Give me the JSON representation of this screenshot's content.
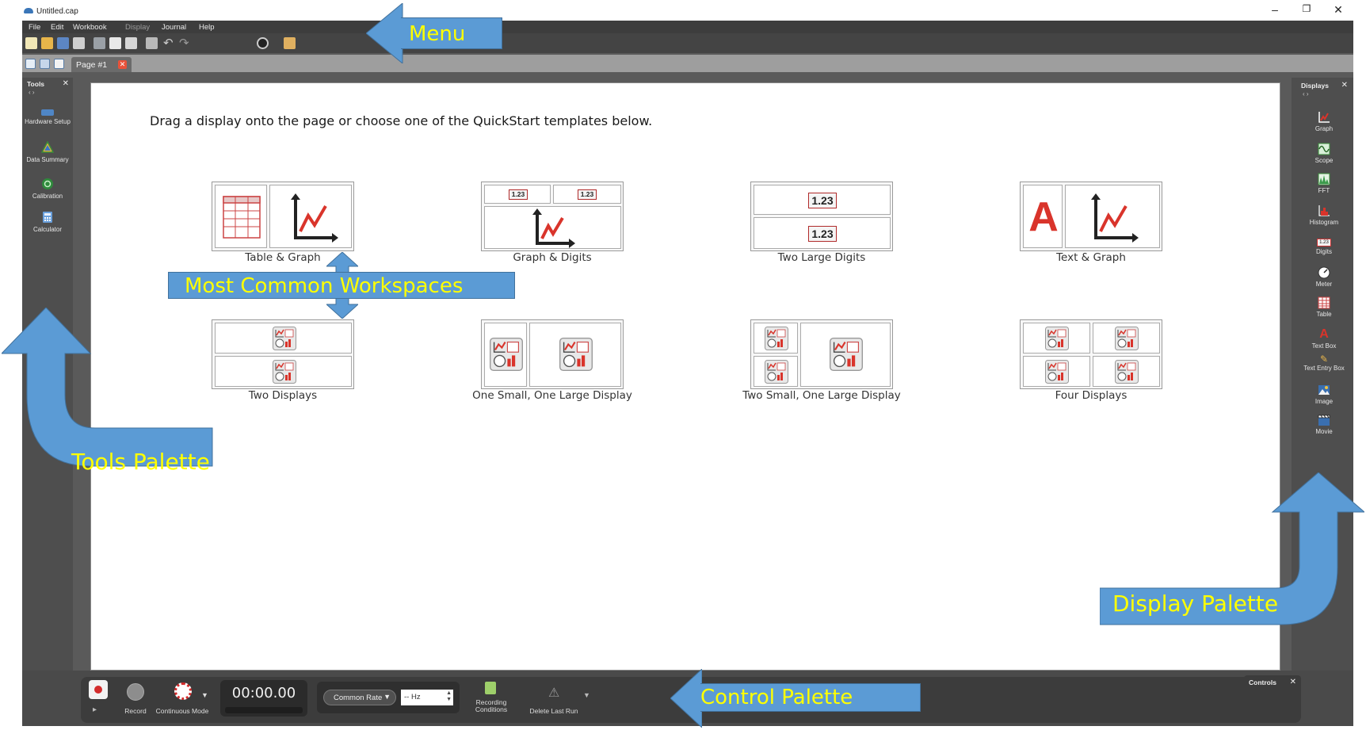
{
  "window": {
    "title": "Untitled.cap",
    "minimize": "–",
    "restore": "❐",
    "close": "✕"
  },
  "menu": {
    "items": [
      "File",
      "Edit",
      "Workbook",
      "Display",
      "Journal",
      "Help"
    ]
  },
  "tabs": {
    "page_label": "Page #1",
    "close": "✕"
  },
  "tools_palette": {
    "title": "Tools",
    "close": "✕",
    "grip": "‹ ›",
    "items": [
      {
        "label": "Hardware Setup",
        "icon": "hardware-setup-icon"
      },
      {
        "label": "Data Summary",
        "icon": "data-summary-icon"
      },
      {
        "label": "Calibration",
        "icon": "calibration-icon"
      },
      {
        "label": "Calculator",
        "icon": "calculator-icon"
      }
    ]
  },
  "displays_palette": {
    "title": "Displays",
    "close": "✕",
    "grip": "‹ ›",
    "items": [
      {
        "label": "Graph",
        "icon": "graph-icon"
      },
      {
        "label": "Scope",
        "icon": "scope-icon"
      },
      {
        "label": "FFT",
        "icon": "fft-icon"
      },
      {
        "label": "Histogram",
        "icon": "histogram-icon"
      },
      {
        "label": "Digits",
        "icon": "digits-icon"
      },
      {
        "label": "Meter",
        "icon": "meter-icon"
      },
      {
        "label": "Table",
        "icon": "table-icon"
      },
      {
        "label": "Text Box",
        "icon": "text-box-icon"
      },
      {
        "label": "Text Entry Box",
        "icon": "text-entry-box-icon"
      },
      {
        "label": "Image",
        "icon": "image-icon"
      },
      {
        "label": "Movie",
        "icon": "movie-icon"
      }
    ]
  },
  "page": {
    "instruction": "Drag a display onto the page or choose one of the QuickStart templates below.",
    "digit_value": "1.23",
    "text_letter": "A",
    "templates": [
      {
        "label": "Table & Graph"
      },
      {
        "label": "Graph & Digits"
      },
      {
        "label": "Two Large Digits"
      },
      {
        "label": "Text & Graph"
      },
      {
        "label": "Two Displays"
      },
      {
        "label": "One Small, One Large Display"
      },
      {
        "label": "Two Small, One Large Display"
      },
      {
        "label": "Four Displays"
      }
    ]
  },
  "controls": {
    "title": "Controls",
    "close": "✕",
    "record_label": "Record",
    "continuous_mode_label": "Continuous Mode",
    "timer": "00:00.00",
    "common_rate_label": "Common Rate",
    "hz_value": "-- Hz",
    "recording_conditions_label": "Recording Conditions",
    "delete_last_run_label": "Delete Last Run"
  },
  "annotations": {
    "menu": "Menu",
    "most_common_workspaces": "Most Common Workspaces",
    "tools_palette": "Tools Palette",
    "display_palette": "Display Palette",
    "control_palette": "Control Palette"
  },
  "colors": {
    "callout_fill": "#5b9bd5",
    "callout_text": "#ffff00",
    "app_dark": "#4e4e4e",
    "graph_red": "#d9342b"
  }
}
